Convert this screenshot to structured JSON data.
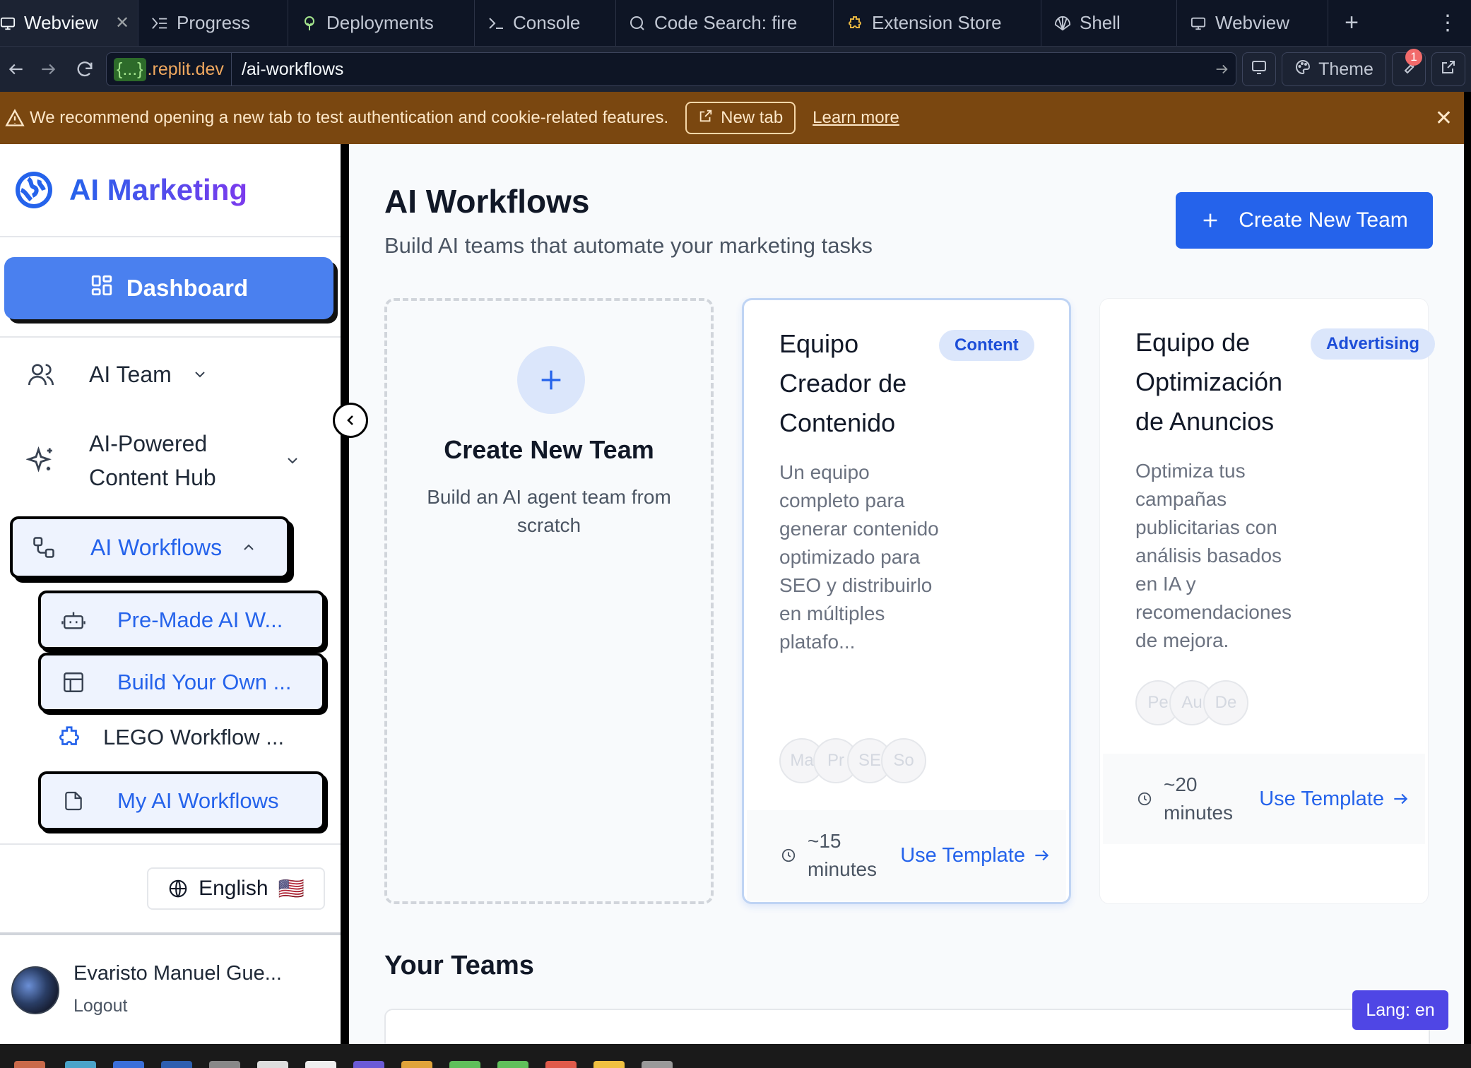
{
  "browser": {
    "tabs": [
      {
        "label": "Webview",
        "icon": "monitor-icon",
        "active": true
      },
      {
        "label": "Progress",
        "icon": "progress-icon"
      },
      {
        "label": "Deployments",
        "icon": "deploy-icon"
      },
      {
        "label": "Console",
        "icon": "terminal-icon"
      },
      {
        "label": "Code Search: fire",
        "icon": "search-icon"
      },
      {
        "label": "Extension Store",
        "icon": "puzzle-icon"
      },
      {
        "label": "Shell",
        "icon": "shell-icon"
      },
      {
        "label": "Webview",
        "icon": "monitor-icon"
      }
    ],
    "url_host_prefix": "{...}",
    "url_host": ".replit.dev",
    "url_path": "/ai-workflows",
    "theme_label": "Theme",
    "notif_count": "1"
  },
  "banner": {
    "message": "We recommend opening a new tab to test authentication and cookie-related features.",
    "new_tab_label": "New tab",
    "learn_more_label": "Learn more"
  },
  "sidebar": {
    "brand": "AI Marketing",
    "dashboard_label": "Dashboard",
    "items": {
      "ai_team": "AI Team",
      "content_hub_line1": "AI-Powered",
      "content_hub_line2": "Content Hub",
      "workflows": "AI Workflows"
    },
    "sub_items": {
      "premade": "Pre-Made AI W...",
      "build": "Build Your Own ...",
      "lego": "LEGO Workflow ...",
      "mine": "My AI Workflows"
    },
    "language": "English",
    "language_flag": "🇺🇸",
    "user_name": "Evaristo Manuel Gue...",
    "logout_label": "Logout"
  },
  "main": {
    "title": "AI Workflows",
    "subtitle": "Build AI teams that automate your marketing tasks",
    "create_button": "Create New Team",
    "new_card": {
      "title": "Create New Team",
      "description": "Build an AI agent team from scratch"
    },
    "templates": [
      {
        "title": "Equipo Creador de Contenido",
        "tag": "Content",
        "description": "Un equipo completo para generar contenido optimizado para SEO y distribuirlo en múltiples platafo...",
        "avatars": [
          "Ma",
          "Pr",
          "SE",
          "So"
        ],
        "time": "~15 minutes",
        "action": "Use Template"
      },
      {
        "title": "Equipo de Optimización de Anuncios",
        "tag": "Advertising",
        "description": "Optimiza tus campañas publicitarias con análisis basados en IA y recomendaciones de mejora.",
        "avatars": [
          "Pe",
          "Au",
          "De"
        ],
        "time": "~20 minutes",
        "action": "Use Template"
      }
    ],
    "your_teams_title": "Your Teams",
    "lang_badge": "Lang: en"
  },
  "colors": {
    "primary": "#2563eb",
    "banner_bg": "#7a4710",
    "tabbar_bg": "#0e1525"
  }
}
